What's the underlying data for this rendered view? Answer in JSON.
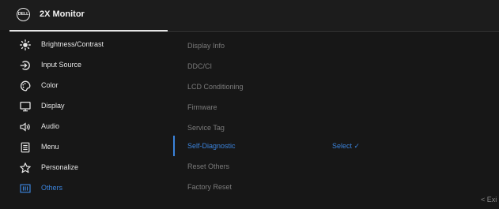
{
  "header": {
    "logo_text": "DELL",
    "title": "2X Monitor"
  },
  "menu": {
    "items": [
      {
        "label": "Brightness/Contrast",
        "icon": "brightness-icon"
      },
      {
        "label": "Input Source",
        "icon": "input-source-icon"
      },
      {
        "label": "Color",
        "icon": "color-palette-icon"
      },
      {
        "label": "Display",
        "icon": "display-icon"
      },
      {
        "label": "Audio",
        "icon": "audio-icon"
      },
      {
        "label": "Menu",
        "icon": "menu-document-icon"
      },
      {
        "label": "Personalize",
        "icon": "star-icon"
      },
      {
        "label": "Others",
        "icon": "others-icon",
        "active": true
      }
    ]
  },
  "submenu": {
    "items": [
      {
        "label": "Display Info"
      },
      {
        "label": "DDC/CI"
      },
      {
        "label": "LCD Conditioning"
      },
      {
        "label": "Firmware"
      },
      {
        "label": "Service Tag"
      },
      {
        "label": "Self-Diagnostic",
        "selected": true
      },
      {
        "label": "Reset Others"
      },
      {
        "label": "Factory Reset"
      }
    ],
    "value": "Select ✓"
  },
  "footer": {
    "exit_label": "< Exi"
  },
  "colors": {
    "background": "#171717",
    "accent": "#3b83db",
    "text": "#e6e6e6",
    "text_dim": "#7b7b7b"
  }
}
